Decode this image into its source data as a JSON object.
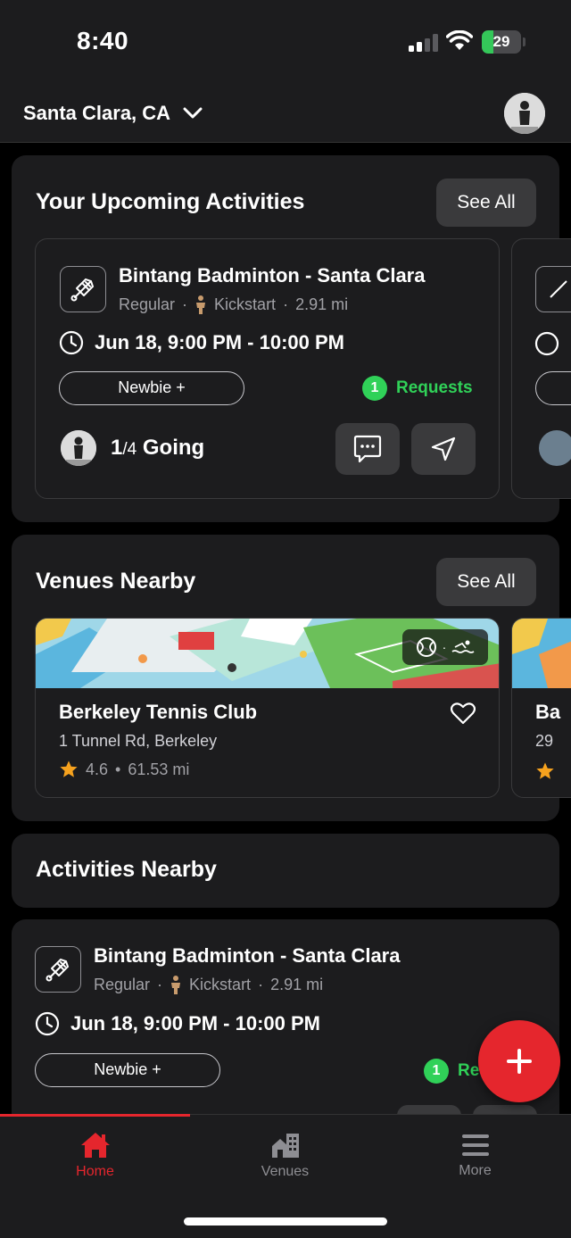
{
  "status": {
    "time": "8:40",
    "battery": "29",
    "battery_level": 0.29
  },
  "header": {
    "location": "Santa Clara, CA"
  },
  "upcoming": {
    "title": "Your Upcoming Activities",
    "see_all": "See All",
    "card": {
      "title": "Bintang Badminton - Santa Clara",
      "type": "Regular",
      "host": "Kickstart",
      "distance": "2.91 mi",
      "time": "Jun 18, 9:00 PM - 10:00 PM",
      "level": "Newbie +",
      "requests_count": "1",
      "requests_label": "Requests",
      "going_count": "1",
      "going_total": "4",
      "going_label": "Going"
    }
  },
  "venues": {
    "title": "Venues Nearby",
    "see_all": "See All",
    "card": {
      "name": "Berkeley Tennis Club",
      "address": "1 Tunnel Rd, Berkeley",
      "rating": "4.6",
      "distance": "61.53 mi"
    },
    "peek": {
      "name": "Ba",
      "address": "29"
    }
  },
  "activities_nearby": {
    "title": "Activities Nearby",
    "card": {
      "title": "Bintang Badminton - Santa Clara",
      "type": "Regular",
      "host": "Kickstart",
      "distance": "2.91 mi",
      "time": "Jun 18, 9:00 PM - 10:00 PM",
      "level": "Newbie +",
      "requests_count": "1",
      "requests_label": "Re"
    }
  },
  "tabs": [
    {
      "label": "Home",
      "icon": "home-icon",
      "active": true
    },
    {
      "label": "Venues",
      "icon": "venues-icon",
      "active": false
    },
    {
      "label": "More",
      "icon": "menu-icon",
      "active": false
    }
  ],
  "colors": {
    "accent": "#e5262d",
    "success": "#30d158",
    "background": "#000000",
    "surface": "#1c1c1e"
  }
}
